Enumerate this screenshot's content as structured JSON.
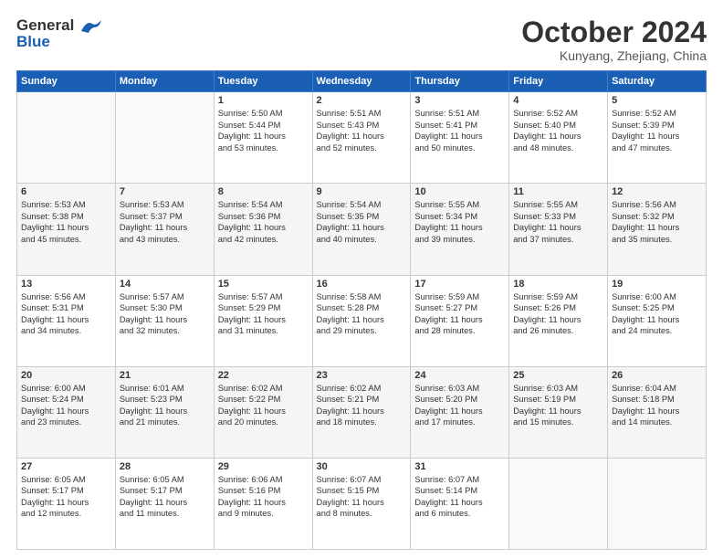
{
  "logo": {
    "line1": "General",
    "line2": "Blue"
  },
  "title": "October 2024",
  "subtitle": "Kunyang, Zhejiang, China",
  "weekdays": [
    "Sunday",
    "Monday",
    "Tuesday",
    "Wednesday",
    "Thursday",
    "Friday",
    "Saturday"
  ],
  "rows": [
    [
      {
        "day": "",
        "lines": []
      },
      {
        "day": "",
        "lines": []
      },
      {
        "day": "1",
        "lines": [
          "Sunrise: 5:50 AM",
          "Sunset: 5:44 PM",
          "Daylight: 11 hours",
          "and 53 minutes."
        ]
      },
      {
        "day": "2",
        "lines": [
          "Sunrise: 5:51 AM",
          "Sunset: 5:43 PM",
          "Daylight: 11 hours",
          "and 52 minutes."
        ]
      },
      {
        "day": "3",
        "lines": [
          "Sunrise: 5:51 AM",
          "Sunset: 5:41 PM",
          "Daylight: 11 hours",
          "and 50 minutes."
        ]
      },
      {
        "day": "4",
        "lines": [
          "Sunrise: 5:52 AM",
          "Sunset: 5:40 PM",
          "Daylight: 11 hours",
          "and 48 minutes."
        ]
      },
      {
        "day": "5",
        "lines": [
          "Sunrise: 5:52 AM",
          "Sunset: 5:39 PM",
          "Daylight: 11 hours",
          "and 47 minutes."
        ]
      }
    ],
    [
      {
        "day": "6",
        "lines": [
          "Sunrise: 5:53 AM",
          "Sunset: 5:38 PM",
          "Daylight: 11 hours",
          "and 45 minutes."
        ]
      },
      {
        "day": "7",
        "lines": [
          "Sunrise: 5:53 AM",
          "Sunset: 5:37 PM",
          "Daylight: 11 hours",
          "and 43 minutes."
        ]
      },
      {
        "day": "8",
        "lines": [
          "Sunrise: 5:54 AM",
          "Sunset: 5:36 PM",
          "Daylight: 11 hours",
          "and 42 minutes."
        ]
      },
      {
        "day": "9",
        "lines": [
          "Sunrise: 5:54 AM",
          "Sunset: 5:35 PM",
          "Daylight: 11 hours",
          "and 40 minutes."
        ]
      },
      {
        "day": "10",
        "lines": [
          "Sunrise: 5:55 AM",
          "Sunset: 5:34 PM",
          "Daylight: 11 hours",
          "and 39 minutes."
        ]
      },
      {
        "day": "11",
        "lines": [
          "Sunrise: 5:55 AM",
          "Sunset: 5:33 PM",
          "Daylight: 11 hours",
          "and 37 minutes."
        ]
      },
      {
        "day": "12",
        "lines": [
          "Sunrise: 5:56 AM",
          "Sunset: 5:32 PM",
          "Daylight: 11 hours",
          "and 35 minutes."
        ]
      }
    ],
    [
      {
        "day": "13",
        "lines": [
          "Sunrise: 5:56 AM",
          "Sunset: 5:31 PM",
          "Daylight: 11 hours",
          "and 34 minutes."
        ]
      },
      {
        "day": "14",
        "lines": [
          "Sunrise: 5:57 AM",
          "Sunset: 5:30 PM",
          "Daylight: 11 hours",
          "and 32 minutes."
        ]
      },
      {
        "day": "15",
        "lines": [
          "Sunrise: 5:57 AM",
          "Sunset: 5:29 PM",
          "Daylight: 11 hours",
          "and 31 minutes."
        ]
      },
      {
        "day": "16",
        "lines": [
          "Sunrise: 5:58 AM",
          "Sunset: 5:28 PM",
          "Daylight: 11 hours",
          "and 29 minutes."
        ]
      },
      {
        "day": "17",
        "lines": [
          "Sunrise: 5:59 AM",
          "Sunset: 5:27 PM",
          "Daylight: 11 hours",
          "and 28 minutes."
        ]
      },
      {
        "day": "18",
        "lines": [
          "Sunrise: 5:59 AM",
          "Sunset: 5:26 PM",
          "Daylight: 11 hours",
          "and 26 minutes."
        ]
      },
      {
        "day": "19",
        "lines": [
          "Sunrise: 6:00 AM",
          "Sunset: 5:25 PM",
          "Daylight: 11 hours",
          "and 24 minutes."
        ]
      }
    ],
    [
      {
        "day": "20",
        "lines": [
          "Sunrise: 6:00 AM",
          "Sunset: 5:24 PM",
          "Daylight: 11 hours",
          "and 23 minutes."
        ]
      },
      {
        "day": "21",
        "lines": [
          "Sunrise: 6:01 AM",
          "Sunset: 5:23 PM",
          "Daylight: 11 hours",
          "and 21 minutes."
        ]
      },
      {
        "day": "22",
        "lines": [
          "Sunrise: 6:02 AM",
          "Sunset: 5:22 PM",
          "Daylight: 11 hours",
          "and 20 minutes."
        ]
      },
      {
        "day": "23",
        "lines": [
          "Sunrise: 6:02 AM",
          "Sunset: 5:21 PM",
          "Daylight: 11 hours",
          "and 18 minutes."
        ]
      },
      {
        "day": "24",
        "lines": [
          "Sunrise: 6:03 AM",
          "Sunset: 5:20 PM",
          "Daylight: 11 hours",
          "and 17 minutes."
        ]
      },
      {
        "day": "25",
        "lines": [
          "Sunrise: 6:03 AM",
          "Sunset: 5:19 PM",
          "Daylight: 11 hours",
          "and 15 minutes."
        ]
      },
      {
        "day": "26",
        "lines": [
          "Sunrise: 6:04 AM",
          "Sunset: 5:18 PM",
          "Daylight: 11 hours",
          "and 14 minutes."
        ]
      }
    ],
    [
      {
        "day": "27",
        "lines": [
          "Sunrise: 6:05 AM",
          "Sunset: 5:17 PM",
          "Daylight: 11 hours",
          "and 12 minutes."
        ]
      },
      {
        "day": "28",
        "lines": [
          "Sunrise: 6:05 AM",
          "Sunset: 5:17 PM",
          "Daylight: 11 hours",
          "and 11 minutes."
        ]
      },
      {
        "day": "29",
        "lines": [
          "Sunrise: 6:06 AM",
          "Sunset: 5:16 PM",
          "Daylight: 11 hours",
          "and 9 minutes."
        ]
      },
      {
        "day": "30",
        "lines": [
          "Sunrise: 6:07 AM",
          "Sunset: 5:15 PM",
          "Daylight: 11 hours",
          "and 8 minutes."
        ]
      },
      {
        "day": "31",
        "lines": [
          "Sunrise: 6:07 AM",
          "Sunset: 5:14 PM",
          "Daylight: 11 hours",
          "and 6 minutes."
        ]
      },
      {
        "day": "",
        "lines": []
      },
      {
        "day": "",
        "lines": []
      }
    ]
  ]
}
